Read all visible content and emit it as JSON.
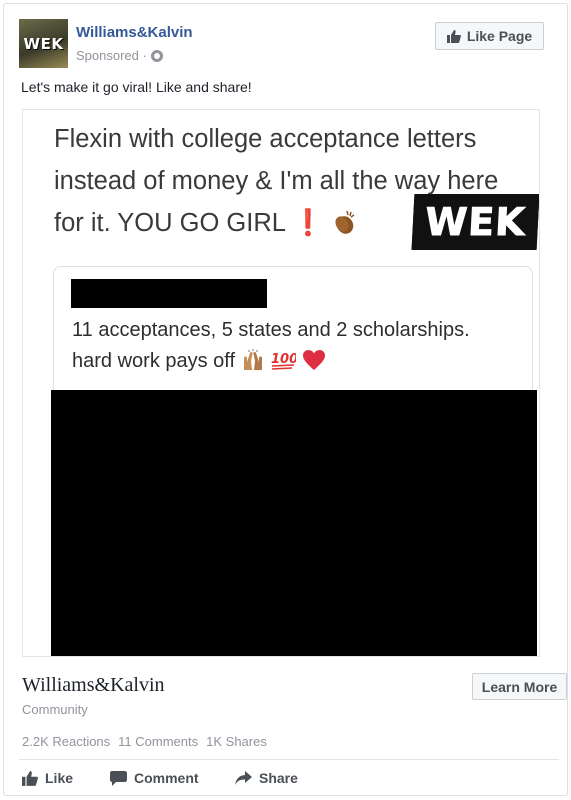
{
  "post": {
    "page_name": "Williams&Kalvin",
    "logo_text": "WEK",
    "sponsored": "Sponsored ·",
    "like_page_label": "Like Page",
    "caption": "Let's make it go viral! Like and share!"
  },
  "media": {
    "headline_line1": "Flexin with college acceptance letters",
    "headline_line2": "instead of money & I'm all the way here",
    "headline_line3": "for it. YOU GO GIRL",
    "exclamation": "❗",
    "badge": "WEK",
    "tweet_line1": "11 acceptances, 5 states and 2 scholarships.",
    "tweet_line2": "hard work pays off"
  },
  "link": {
    "title": "Williams&Kalvin",
    "subtitle": "Community",
    "learn_more_label": "Learn More"
  },
  "stats": {
    "reactions": "2.2K Reactions",
    "comments": "11 Comments",
    "shares": "1K Shares"
  },
  "actions": {
    "like": "Like",
    "comment": "Comment",
    "share": "Share"
  },
  "icons": {
    "globe": "globe-icon",
    "thumb": "thumbs-up-icon",
    "clap": "clapping-hands-icon",
    "praise": "raised-hands-icon",
    "hundred": "hundred-points-icon",
    "heart": "red-heart-icon",
    "comment": "speech-bubble-icon",
    "share": "share-arrow-icon"
  },
  "colors": {
    "link_blue": "#365899",
    "muted_gray": "#90949c",
    "button_bg": "#f6f7f9",
    "button_text": "#4b4f56",
    "exclamation_red": "#d8232a"
  }
}
